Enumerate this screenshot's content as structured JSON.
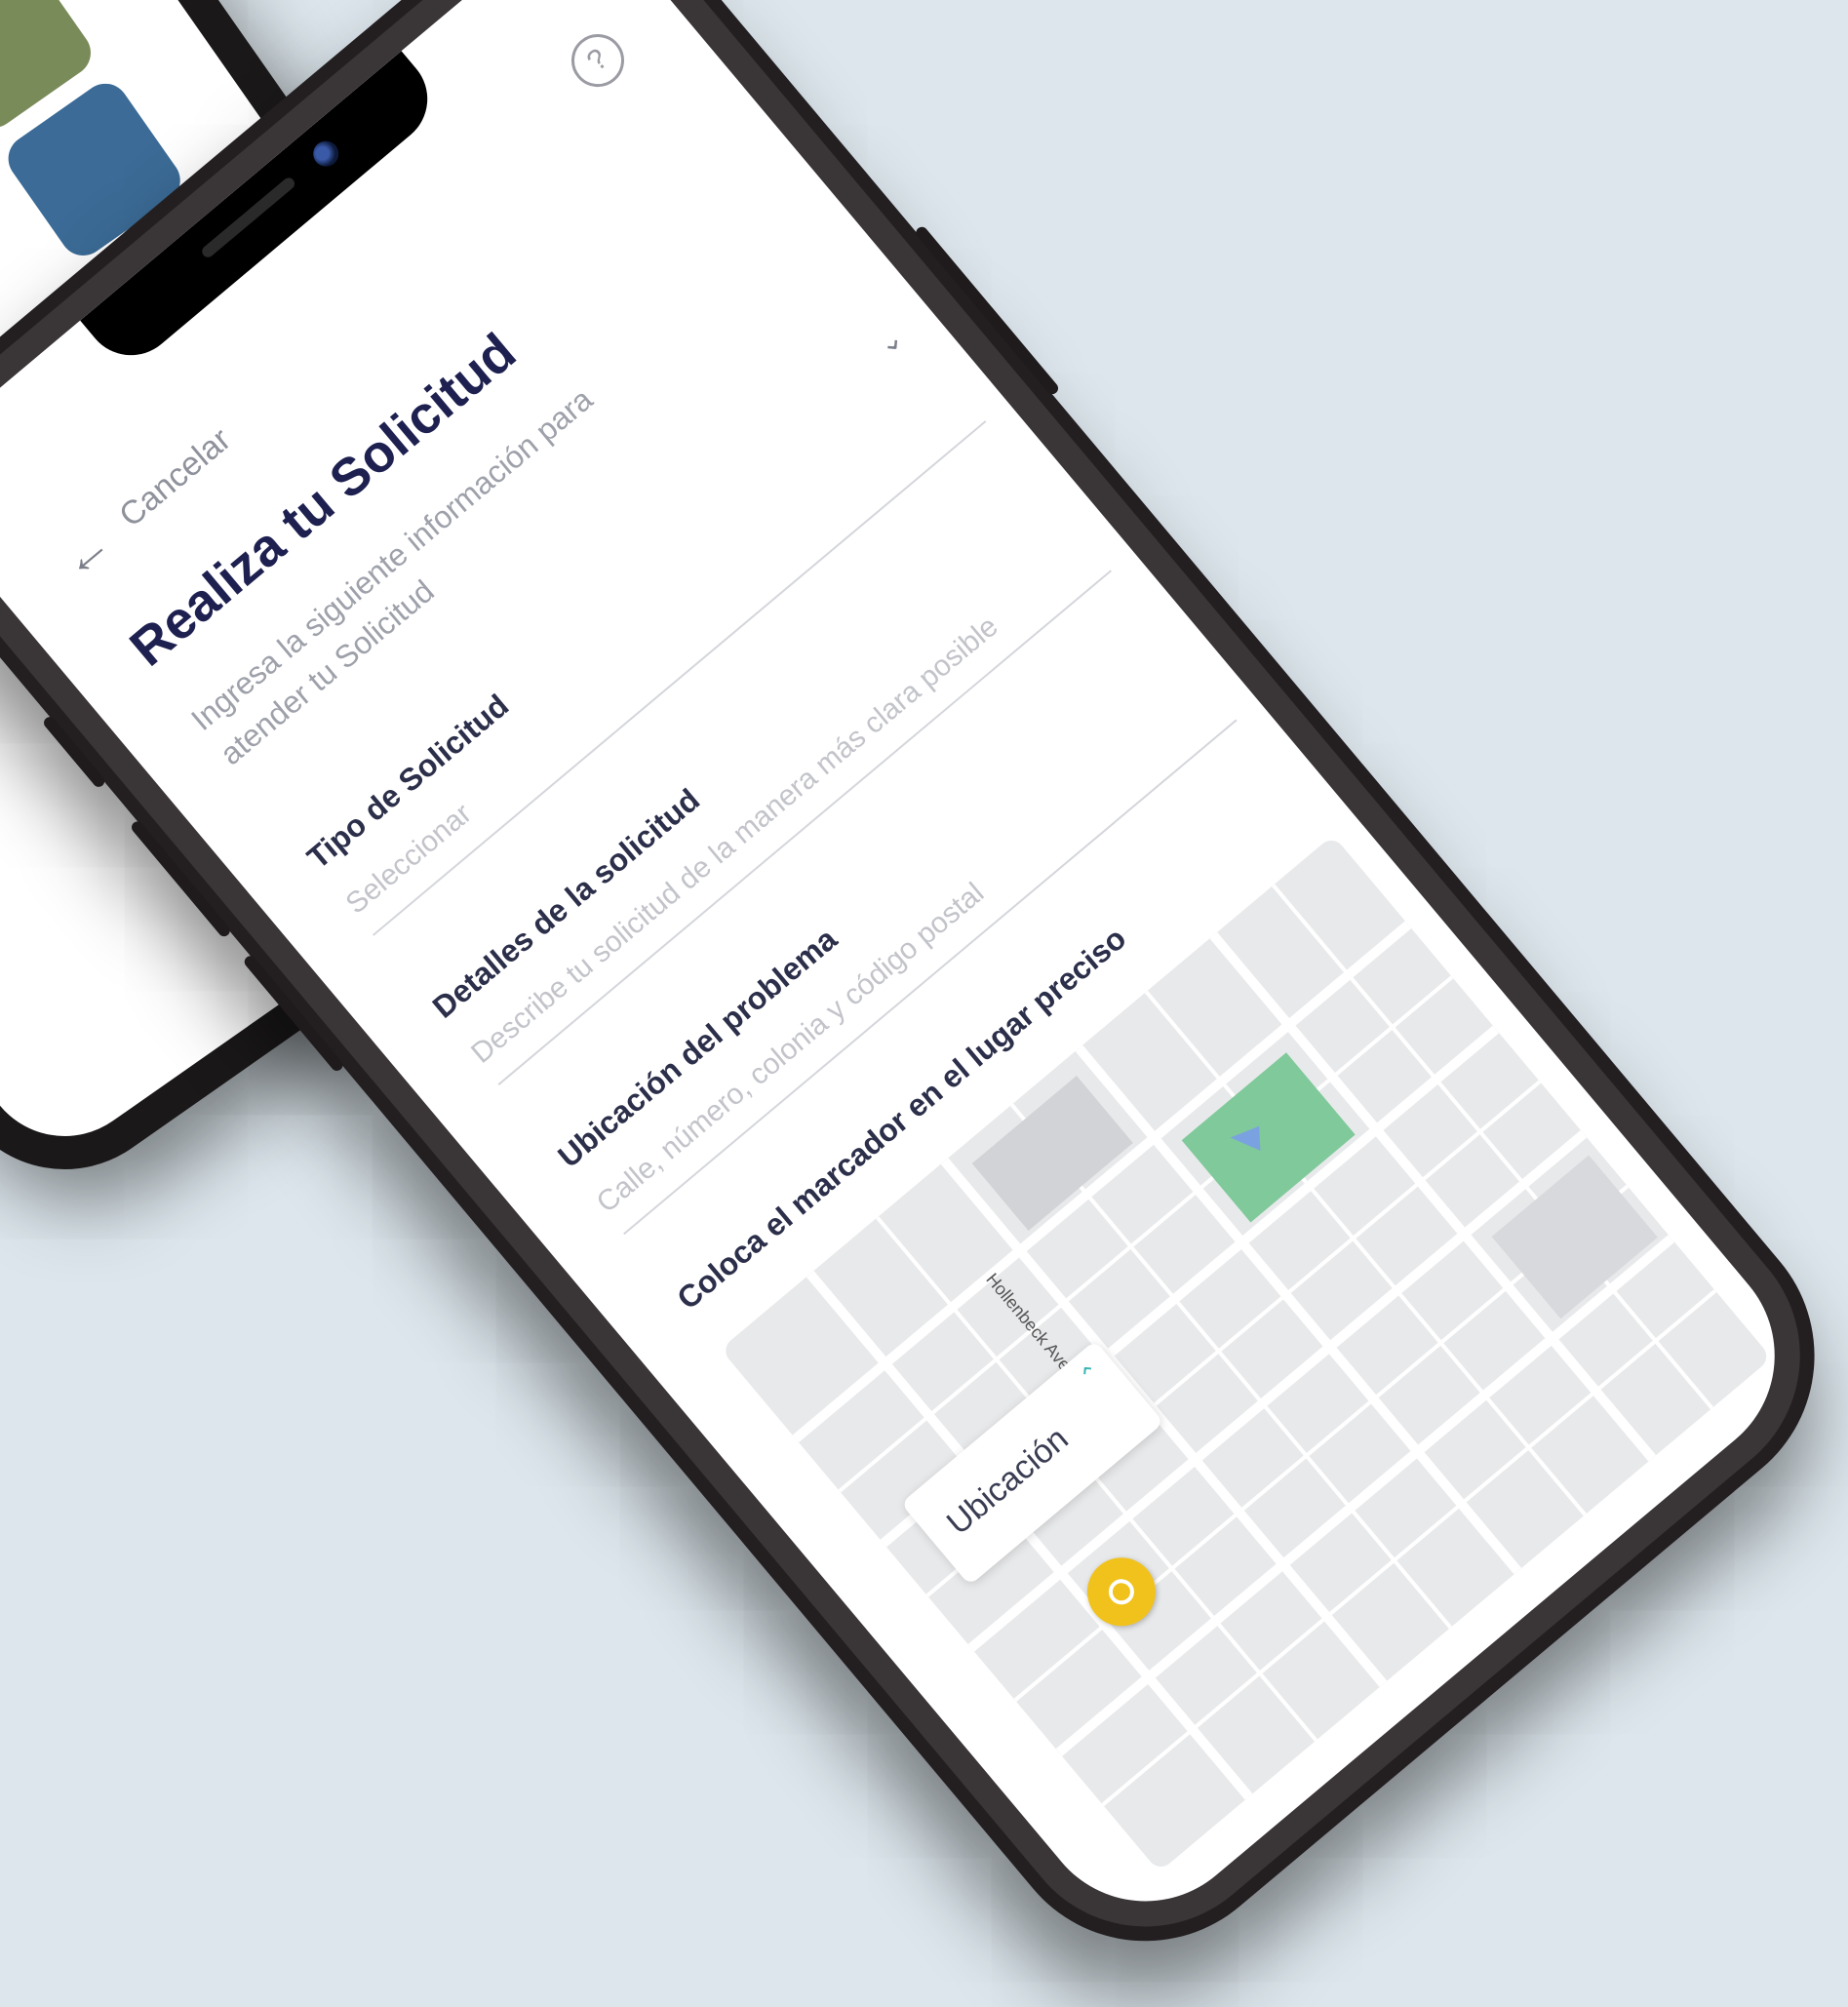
{
  "header": {
    "cancel_label": "Cancelar",
    "back_icon": "arrow-left-icon",
    "help_icon": "help-circle-icon",
    "help_glyph": "?"
  },
  "page": {
    "title": "Realiza tu Solicitud",
    "subtitle": "Ingresa la siguiente información para atender tu Solicitud"
  },
  "form": {
    "type": {
      "label": "Tipo de Solicitud",
      "placeholder": "Seleccionar"
    },
    "details": {
      "label": "Detalles de la solicitud",
      "placeholder": "Describe tu solicitud de la manera más clara posible"
    },
    "location": {
      "label": "Ubicación del problema",
      "placeholder": "Calle, número, colonia y código postal"
    }
  },
  "map": {
    "instruction": "Coloca el marcador en el lugar preciso",
    "street_label": "Hollenbeck Ave",
    "card_title": "Ubicación"
  },
  "colors": {
    "background": "#dce6ec",
    "title": "#1e2150",
    "pin": "#f1c21b",
    "park": "#7fc99a"
  }
}
